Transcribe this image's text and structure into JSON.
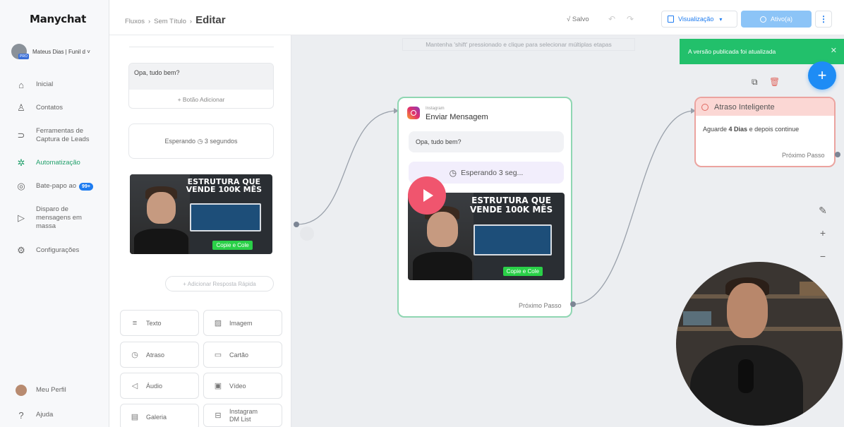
{
  "sidebar": {
    "logo": "Manychat",
    "account": "Mateus Dias | Funil d ˅",
    "pro_badge": "PRO",
    "items": [
      {
        "label": "Inicial"
      },
      {
        "label": "Contatos"
      },
      {
        "label": "Ferramentas de Captura de Leads"
      },
      {
        "label": "Automatização"
      },
      {
        "label": "Bate-papo ao",
        "badge": "99+"
      },
      {
        "label": "Disparo de mensagens em massa"
      },
      {
        "label": "Configurações"
      }
    ],
    "profile": "Meu Perfil",
    "help": "Ajuda"
  },
  "topbar": {
    "breadcrumb": [
      "Fluxos",
      "Sem Título",
      "Editar"
    ],
    "saved": "√ Salvo",
    "visualize": "Visualização",
    "active": "Ativo(a)"
  },
  "canvas": {
    "hint": "Mantenha 'shift' pressionado e clique para selecionar múltiplas etapas",
    "toast": "A versão publicada foi atualizada"
  },
  "panel": {
    "message": "Opa, tudo bem?",
    "add_button": "+ Botão Adicionar",
    "waiting": "Esperando ◷ 3 segundos",
    "quick_reply": "+ Adicionar Resposta Rápida",
    "tools": [
      "Texto",
      "Imagem",
      "Atraso",
      "Cartão",
      "Áudio",
      "Vídeo",
      "Galeria",
      "Instagram DM List"
    ]
  },
  "thumbnail": {
    "headline": "ESTRUTURA QUE VENDE 100K MÊS",
    "cta": "Copie e Cole"
  },
  "node_instagram": {
    "platform": "Instagram",
    "title": "Enviar Mensagem",
    "message": "Opa, tudo bem?",
    "waiting": "Esperando 3 seg...",
    "next": "Próximo Passo"
  },
  "node_delay": {
    "title": "Atraso Inteligente",
    "body_prefix": "Aguarde ",
    "body_bold": "4 Dias",
    "body_suffix": " e depois continue",
    "next": "Próximo Passo"
  },
  "colors": {
    "accent": "#1e8cf5",
    "active_green": "#22a06b",
    "toast_green": "#22c06b",
    "node_green_border": "#8fd6b2",
    "node_red_border": "#eba39f"
  }
}
